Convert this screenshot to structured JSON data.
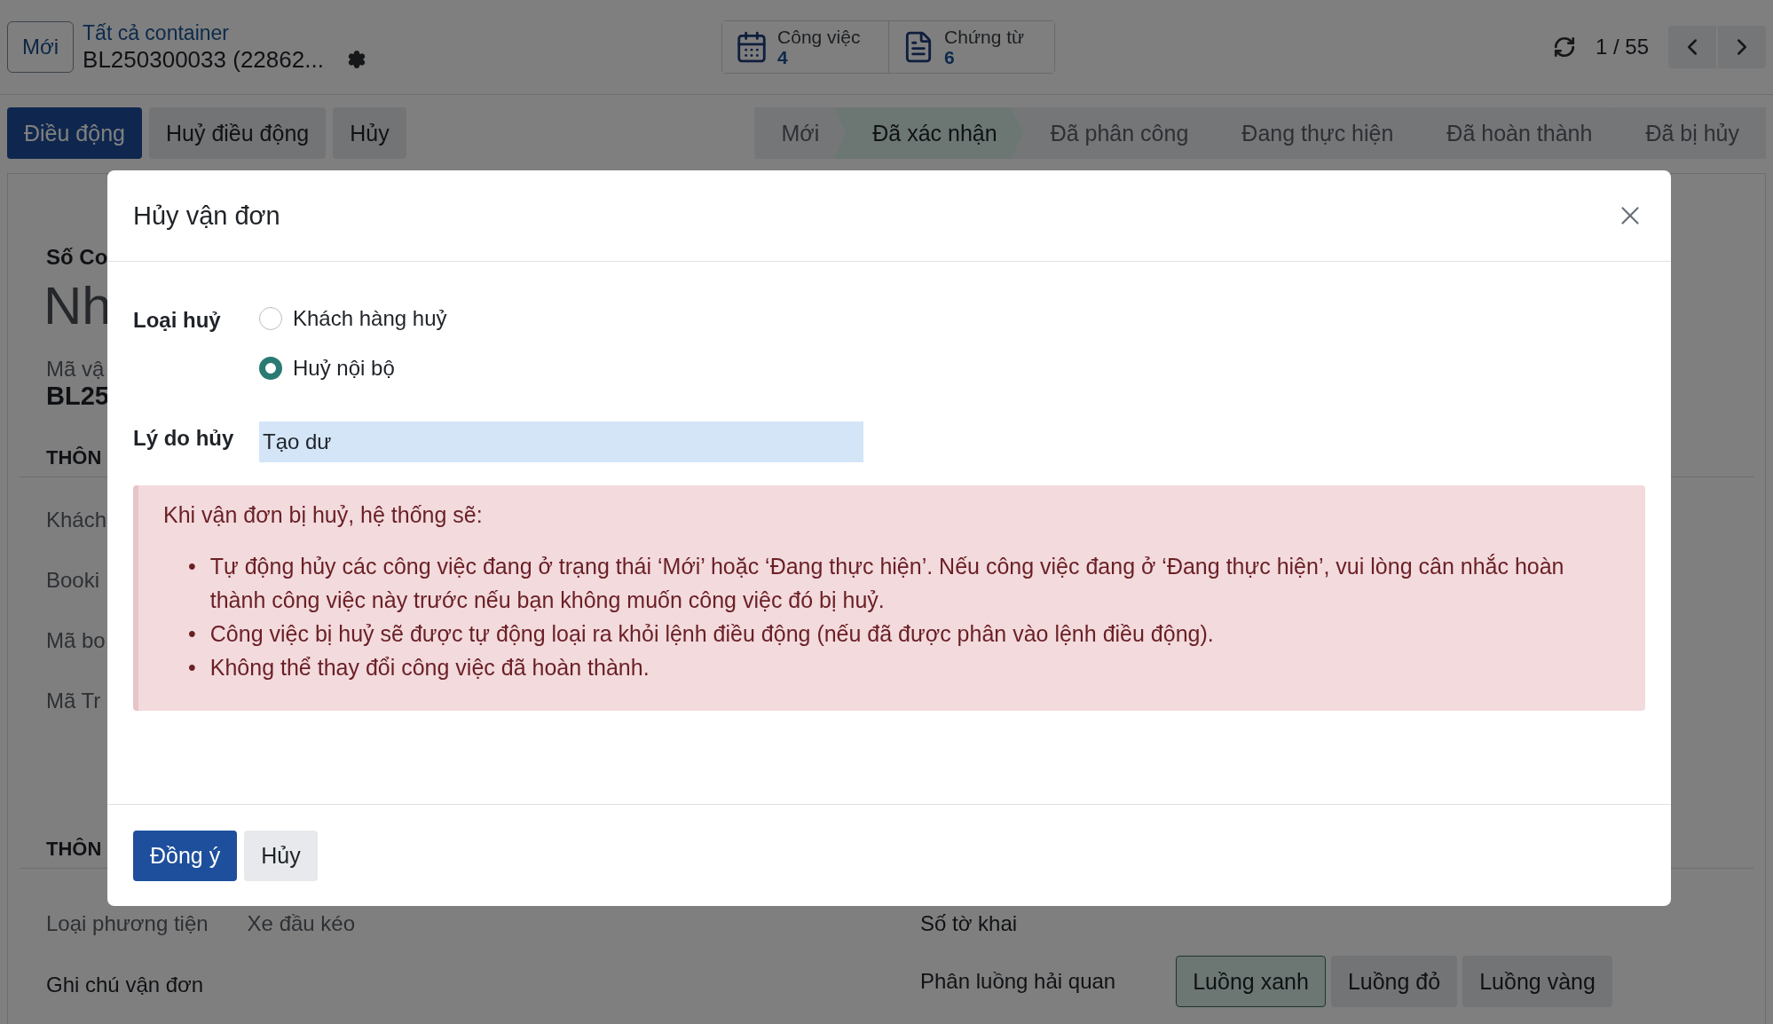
{
  "control_panel": {
    "new_button": "Mới",
    "breadcrumb": "Tất cả container",
    "record_title": "BL250300033 (22862...",
    "stat_buttons": [
      {
        "kind": "calendar",
        "label": "Công việc",
        "value": "4"
      },
      {
        "kind": "document",
        "label": "Chứng từ",
        "value": "6"
      }
    ],
    "pager": "1 / 55"
  },
  "action_buttons": [
    {
      "label": "Điều động",
      "kind": "primary"
    },
    {
      "label": "Huỷ điều động",
      "kind": "secondary"
    },
    {
      "label": "Hủy",
      "kind": "secondary"
    }
  ],
  "status_steps": [
    {
      "label": "Mới",
      "selected": false
    },
    {
      "label": "Đã xác nhận",
      "selected": true
    },
    {
      "label": "Đã phân công",
      "selected": false
    },
    {
      "label": "Đang thực hiện",
      "selected": false
    },
    {
      "label": "Đã hoàn thành",
      "selected": false
    },
    {
      "label": "Đã bị hủy",
      "selected": false
    }
  ],
  "form": {
    "field_label": "Số Co",
    "title": "Nh",
    "ref_label": "Mã vậ",
    "ref_value": "BL25",
    "sections": [
      {
        "heading": "THÔN",
        "fields": [
          "Khách",
          "Booki",
          "Mã bo",
          "Mã Tr"
        ]
      },
      {
        "heading": "THÔN"
      }
    ],
    "vehicle_label": "Loại phương tiện",
    "vehicle_value": "Xe đầu kéo",
    "declaration_label": "Số tờ khai",
    "note_label": "Ghi chú vận đơn",
    "customs_label": "Phân luồng hải quan",
    "customs_options": [
      {
        "label": "Luồng xanh",
        "selected": true
      },
      {
        "label": "Luồng đỏ",
        "selected": false
      },
      {
        "label": "Luồng vàng",
        "selected": false
      }
    ]
  },
  "dialog": {
    "title": "Hủy vận đơn",
    "cancel_type": {
      "label": "Loại huỷ",
      "options": [
        {
          "label": "Khách hàng huỷ",
          "selected": false
        },
        {
          "label": "Huỷ nội bộ",
          "selected": true
        }
      ]
    },
    "reason": {
      "label": "Lý do hủy",
      "value": "Tạo dư"
    },
    "alert": {
      "bullet": "•",
      "intro": "Khi vận đơn bị huỷ, hệ thống sẽ:",
      "items": [
        "Tự động hủy các công việc đang ở trạng thái ‘Mới’ hoặc ‘Đang thực hiện’. Nếu công việc đang ở ‘Đang thực hiện’, vui lòng cân nhắc hoàn thành công việc này trước nếu bạn không muốn công việc đó bị huỷ.",
        "Công việc bị huỷ sẽ được tự động loại ra khỏi lệnh điều động (nếu đã được phân vào lệnh điều động).",
        "Không thể thay đổi công việc đã hoàn thành."
      ]
    },
    "buttons": [
      {
        "label": "Đồng ý",
        "kind": "primary"
      },
      {
        "label": "Hủy",
        "kind": "secondary"
      }
    ]
  }
}
